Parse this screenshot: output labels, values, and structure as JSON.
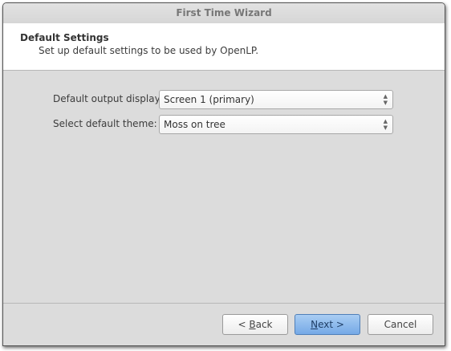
{
  "window": {
    "title": "First Time Wizard"
  },
  "header": {
    "title": "Default Settings",
    "subtitle": "Set up default settings to be used by OpenLP."
  },
  "form": {
    "output_display": {
      "label": "Default output display:",
      "value": "Screen 1 (primary)"
    },
    "theme": {
      "label": "Select default theme:",
      "value": "Moss on tree"
    }
  },
  "buttons": {
    "back": {
      "prefix": "< ",
      "mnemonic": "B",
      "rest": "ack"
    },
    "next": {
      "prefix": "",
      "mnemonic": "N",
      "rest": "ext >"
    },
    "cancel": {
      "label": "Cancel"
    }
  },
  "colors": {
    "accent": "#75a9e6"
  }
}
